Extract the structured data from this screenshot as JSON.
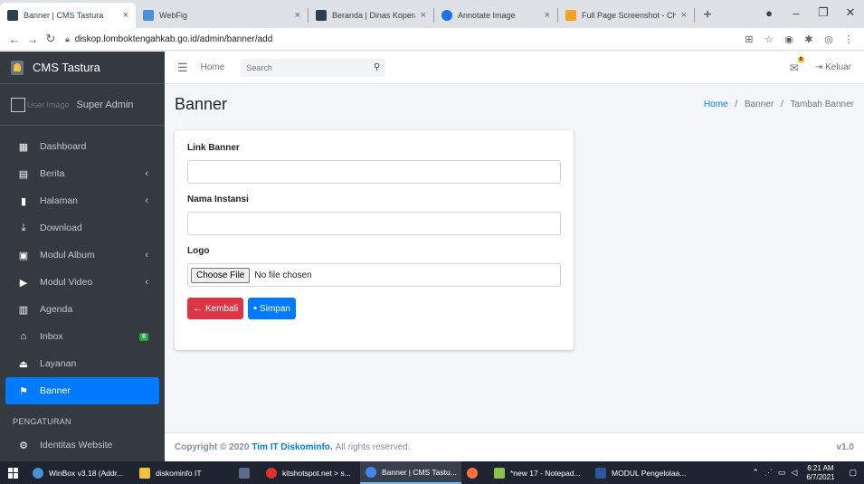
{
  "browser": {
    "tabs": [
      {
        "title": "Banner | CMS Tastura",
        "favicon_color": "#2c3e50",
        "active": true
      },
      {
        "title": "WebFig",
        "favicon_color": "#4a90d9",
        "active": false
      },
      {
        "title": "Beranda | Dinas Koperasi dan",
        "favicon_color": "#2c3e50",
        "active": false
      },
      {
        "title": "Annotate Image",
        "favicon_color": "#1a73e8",
        "active": false
      },
      {
        "title": "Full Page Screenshot - Chrom",
        "favicon_color": "#f4a21e",
        "active": false
      }
    ],
    "close_glyph": "×",
    "newtab_glyph": "+",
    "url": "diskop.lomboktengahkab.go.id/admin/banner/add"
  },
  "sidebar": {
    "brand": "CMS Tastura",
    "user_image_alt": "User Image",
    "user_name": "Super Admin",
    "items": [
      {
        "label": "Dashboard",
        "icon": "grid-icon",
        "glyph": "▦",
        "has_chevron": false
      },
      {
        "label": "Berita",
        "icon": "newspaper-icon",
        "glyph": "▤",
        "has_chevron": true
      },
      {
        "label": "Halaman",
        "icon": "file-icon",
        "glyph": "▮",
        "has_chevron": true
      },
      {
        "label": "Download",
        "icon": "download-icon",
        "glyph": "⤓",
        "has_chevron": false
      },
      {
        "label": "Modul Album",
        "icon": "images-icon",
        "glyph": "▣",
        "has_chevron": true
      },
      {
        "label": "Modul Video",
        "icon": "play-circle-icon",
        "glyph": "▶",
        "has_chevron": true
      },
      {
        "label": "Agenda",
        "icon": "calendar-icon",
        "glyph": "▥",
        "has_chevron": false
      },
      {
        "label": "Inbox",
        "icon": "inbox-icon",
        "glyph": "⌂",
        "badge": "0"
      },
      {
        "label": "Layanan",
        "icon": "eject-icon",
        "glyph": "⏏",
        "has_chevron": false
      },
      {
        "label": "Banner",
        "icon": "flag-icon",
        "glyph": "⚑",
        "active": true
      }
    ],
    "chevron_glyph": "‹",
    "section_header": "PENGATURAN",
    "partial_item": "Identitas Website"
  },
  "topnav": {
    "home": "Home",
    "search_placeholder": "Search",
    "mail_badge": "0",
    "logout": "Keluar"
  },
  "page": {
    "title": "Banner",
    "breadcrumb": [
      "Home",
      "Banner",
      "Tambah Banner"
    ],
    "breadcrumb_sep": "/"
  },
  "form": {
    "link_label": "Link Banner",
    "nama_label": "Nama Instansi",
    "logo_label": "Logo",
    "choose_file": "Choose File",
    "no_file": "No file chosen",
    "back_button": "Kembali",
    "save_button": "Simpan"
  },
  "footer": {
    "copyright": "Copyright © 2020",
    "company": "Tim IT Diskominfo.",
    "rights": "All rights reserved.",
    "version": "v1.0"
  },
  "taskbar": {
    "items": [
      {
        "label": "WinBox v3.18 (Addr...",
        "color": "#4a90d9"
      },
      {
        "label": "diskominfo IT",
        "color": "#f6c23e"
      },
      {
        "label": "",
        "color": "#5a6b8c"
      },
      {
        "label": "kitshotspot.net > s...",
        "color": "#e0312e"
      },
      {
        "label": "Banner | CMS Tastu...",
        "color": "#4285f4",
        "active": true
      },
      {
        "label": "",
        "color": "#ff7139"
      },
      {
        "label": "*new 17 - Notepad...",
        "color": "#8bc34a"
      },
      {
        "label": "MODUL Pengelolaa...",
        "color": "#2b579a"
      }
    ],
    "time": "6:21 AM",
    "date": "6/7/2021"
  },
  "colors": {
    "sidebar_bg": "#343a40",
    "primary": "#007bff",
    "danger": "#dc3545",
    "success": "#28a745"
  }
}
